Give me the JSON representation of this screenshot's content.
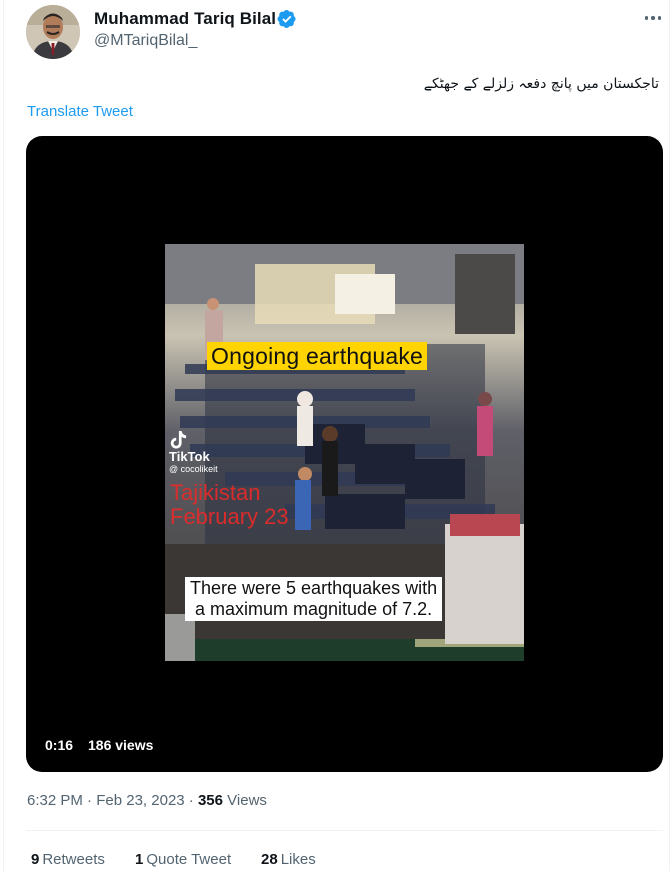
{
  "author": {
    "name": "Muhammad Tariq Bilal",
    "handle": "@MTariqBilal_",
    "verified": true
  },
  "tweet": {
    "text": "تاجکستان میں پانچ دفعہ زلزلے کے جھٹکے",
    "translate_label": "Translate Tweet"
  },
  "media": {
    "caption_top": "Ongoing earthquake",
    "overlay_location": "Tajikistan",
    "overlay_date": "February 23",
    "tiktok_brand": "TikTok",
    "tiktok_user": "@ cocolikeit",
    "caption_bottom_line1": "There were 5 earthquakes with",
    "caption_bottom_line2": "a maximum magnitude of 7.2.",
    "duration": "0:16",
    "views": "186 views"
  },
  "meta": {
    "time": "6:32 PM",
    "date": "Feb 23, 2023",
    "views_count": "356",
    "views_label": "Views"
  },
  "stats": {
    "retweets_count": "9",
    "retweets_label": "Retweets",
    "quotes_count": "1",
    "quotes_label": "Quote Tweet",
    "likes_count": "28",
    "likes_label": "Likes"
  },
  "colors": {
    "accent": "#1d9bf0",
    "text": "#0f1419",
    "secondary": "#536471",
    "caption_yellow": "#ffd400",
    "overlay_red": "#e82a2a"
  }
}
